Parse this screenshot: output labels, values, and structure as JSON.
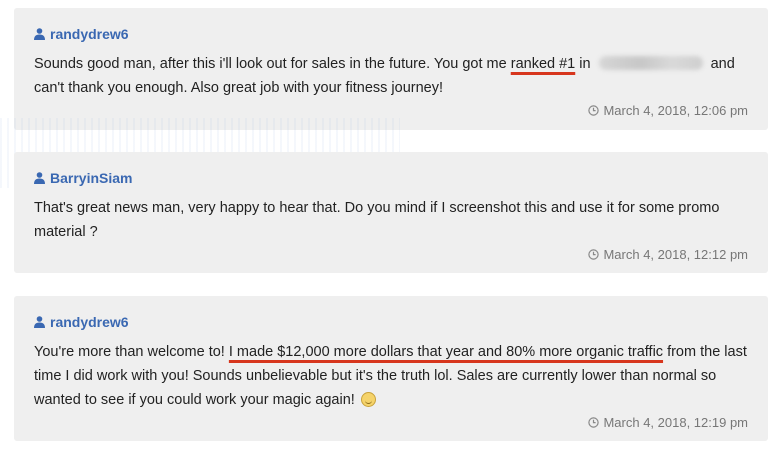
{
  "comments": [
    {
      "author": "randydrew6",
      "text_before": "Sounds good man, after this i'll look out for sales in the future. You got me ",
      "text_highlight": "ranked #1",
      "text_mid": " in ",
      "text_after": " and can't thank you enough. Also great job with your fitness journey!",
      "timestamp": "March 4, 2018, 12:06 pm"
    },
    {
      "author": "BarryinSiam",
      "text": "That's great news man, very happy to hear that. Do you mind if I screenshot this and use it for some promo material ?",
      "timestamp": "March 4, 2018, 12:12 pm"
    },
    {
      "author": "randydrew6",
      "text_before": "You're more than welcome to! ",
      "text_highlight": "I made $12,000 more dollars that year and 80% more organic traffic",
      "text_after": " from the last time I did work with you! Sounds unbelievable but it's the truth lol. Sales are currently lower than normal so wanted to see if you could work your magic again! ",
      "timestamp": "March 4, 2018, 12:19 pm"
    }
  ],
  "icons": {
    "user": "user-icon",
    "clock": "clock-icon",
    "emoji": "grin-emoji-icon"
  },
  "colors": {
    "author": "#3a68b2",
    "highlight_underline": "#d7361d",
    "card_bg": "#efefef",
    "timestamp": "#777777"
  }
}
